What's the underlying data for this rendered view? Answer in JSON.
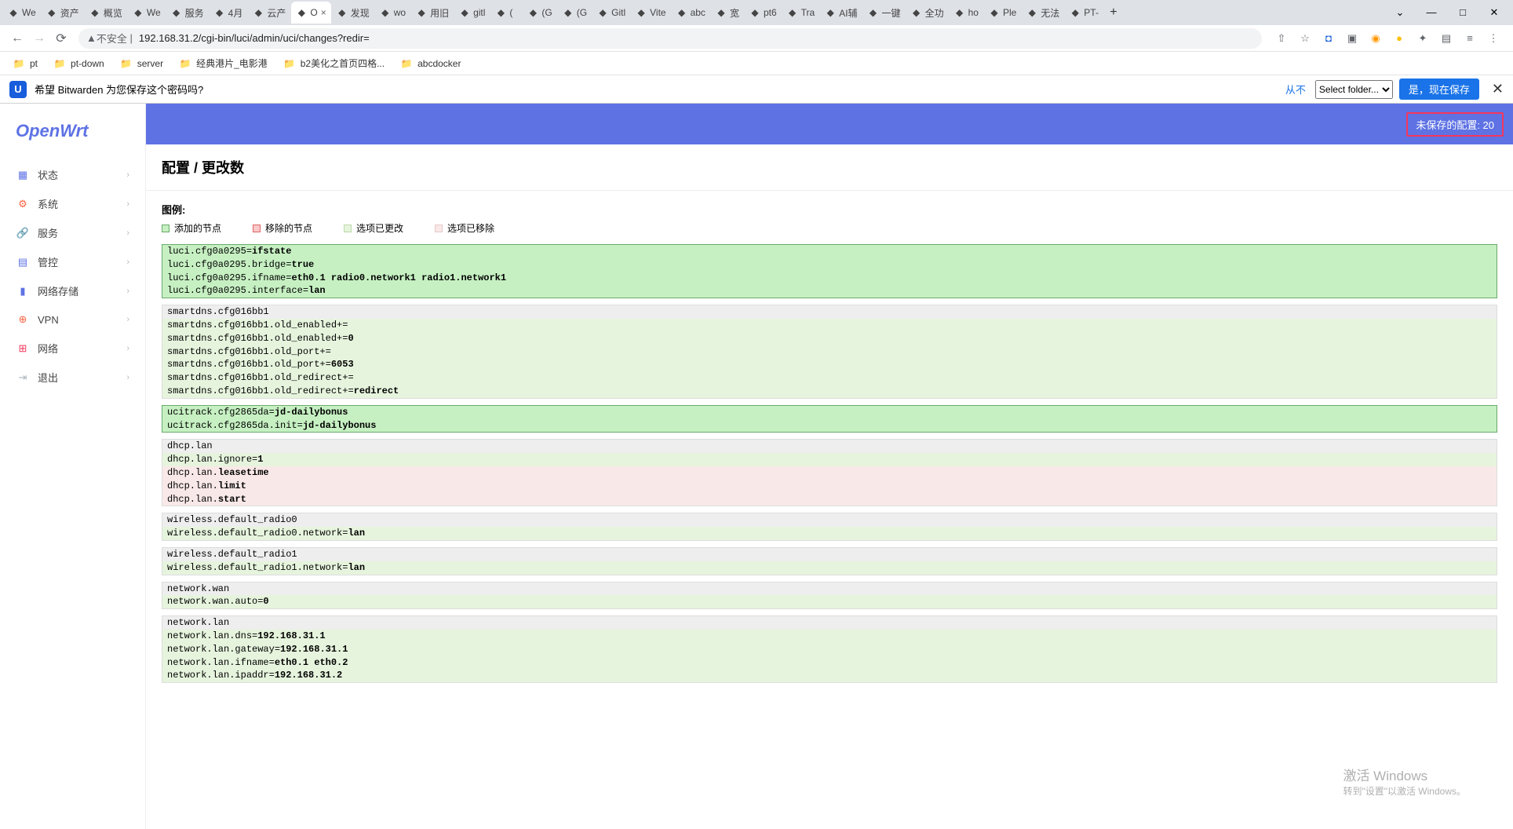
{
  "browser": {
    "tabs": [
      {
        "label": "We"
      },
      {
        "label": "资产"
      },
      {
        "label": "概览"
      },
      {
        "label": "We"
      },
      {
        "label": "服务"
      },
      {
        "label": "4月"
      },
      {
        "label": "云产"
      },
      {
        "label": "O",
        "active": true
      },
      {
        "label": "发现"
      },
      {
        "label": "wo"
      },
      {
        "label": "用旧"
      },
      {
        "label": "gitl"
      },
      {
        "label": "("
      },
      {
        "label": "(G"
      },
      {
        "label": "(G"
      },
      {
        "label": "Gitl"
      },
      {
        "label": "Vite"
      },
      {
        "label": "abc"
      },
      {
        "label": "宽"
      },
      {
        "label": "pt6"
      },
      {
        "label": "Tra"
      },
      {
        "label": "AI辅"
      },
      {
        "label": "一键"
      },
      {
        "label": "全功"
      },
      {
        "label": "ho"
      },
      {
        "label": "Ple"
      },
      {
        "label": "无法"
      },
      {
        "label": "PT-"
      }
    ],
    "url_insecure": "不安全",
    "url": "192.168.31.2/cgi-bin/luci/admin/uci/changes?redir=",
    "bookmarks": [
      {
        "label": "pt"
      },
      {
        "label": "pt-down"
      },
      {
        "label": "server"
      },
      {
        "label": "经典港片_电影港"
      },
      {
        "label": "b2美化之首页四格..."
      },
      {
        "label": "abcdocker"
      }
    ]
  },
  "bitwarden": {
    "prompt": "希望 Bitwarden 为您保存这个密码吗?",
    "never": "从不",
    "folder_placeholder": "Select folder...",
    "save": "是，现在保存"
  },
  "app": {
    "logo": "OpenWrt",
    "nav": [
      {
        "label": "状态",
        "icon": "dashboard",
        "color": "#5e72e4"
      },
      {
        "label": "系统",
        "icon": "gear",
        "color": "#fb6340"
      },
      {
        "label": "服务",
        "icon": "share",
        "color": "#2dce89"
      },
      {
        "label": "管控",
        "icon": "list",
        "color": "#5e72e4"
      },
      {
        "label": "网络存储",
        "icon": "sd",
        "color": "#5e72e4"
      },
      {
        "label": "VPN",
        "icon": "vpn",
        "color": "#fb6340"
      },
      {
        "label": "网络",
        "icon": "network",
        "color": "#f5365c"
      },
      {
        "label": "退出",
        "icon": "logout",
        "color": "#adb5bd"
      }
    ],
    "unsaved_label": "未保存的配置: 20",
    "page_title": "配置 / 更改数",
    "legend_title": "图例:",
    "legend": {
      "add": "添加的节点",
      "remove": "移除的节点",
      "changed": "选项已更改",
      "removed_opt": "选项已移除"
    },
    "blocks": [
      {
        "type": "addsection",
        "lines": [
          {
            "pre": "luci.cfg0a0295=",
            "val": "ifstate"
          },
          {
            "pre": "luci.cfg0a0295.bridge=",
            "val": "true"
          },
          {
            "pre": "luci.cfg0a0295.ifname=",
            "val": "eth0.1 radio0.network1 radio1.network1"
          },
          {
            "pre": "luci.cfg0a0295.interface=",
            "val": "lan"
          }
        ]
      },
      {
        "type": "mixed",
        "lines": [
          {
            "pre": "smartdns.cfg016bb1",
            "val": "",
            "style": "header"
          },
          {
            "pre": "smartdns.cfg016bb1.old_enabled+=",
            "val": "",
            "style": "changed"
          },
          {
            "pre": "smartdns.cfg016bb1.old_enabled+=",
            "val": "0",
            "style": "changed"
          },
          {
            "pre": "smartdns.cfg016bb1.old_port+=",
            "val": "",
            "style": "changed"
          },
          {
            "pre": "smartdns.cfg016bb1.old_port+=",
            "val": "6053",
            "style": "changed"
          },
          {
            "pre": "smartdns.cfg016bb1.old_redirect+=",
            "val": "",
            "style": "changed"
          },
          {
            "pre": "smartdns.cfg016bb1.old_redirect+=",
            "val": "redirect",
            "style": "changed"
          }
        ]
      },
      {
        "type": "addsection",
        "lines": [
          {
            "pre": "ucitrack.cfg2865da=",
            "val": "jd-dailybonus"
          },
          {
            "pre": "ucitrack.cfg2865da.init=",
            "val": "jd-dailybonus"
          }
        ]
      },
      {
        "type": "mixed",
        "lines": [
          {
            "pre": "dhcp.lan",
            "val": "",
            "style": "header"
          },
          {
            "pre": "dhcp.lan.ignore=",
            "val": "1",
            "style": "changed"
          },
          {
            "pre": "dhcp.lan.",
            "val": "leasetime",
            "style": "removed"
          },
          {
            "pre": "dhcp.lan.",
            "val": "limit",
            "style": "removed"
          },
          {
            "pre": "dhcp.lan.",
            "val": "start",
            "style": "removed"
          }
        ]
      },
      {
        "type": "mixed",
        "lines": [
          {
            "pre": "wireless.default_radio0",
            "val": "",
            "style": "header"
          },
          {
            "pre": "wireless.default_radio0.network=",
            "val": "lan",
            "style": "changed"
          }
        ]
      },
      {
        "type": "mixed",
        "lines": [
          {
            "pre": "wireless.default_radio1",
            "val": "",
            "style": "header"
          },
          {
            "pre": "wireless.default_radio1.network=",
            "val": "lan",
            "style": "changed"
          }
        ]
      },
      {
        "type": "mixed",
        "lines": [
          {
            "pre": "network.wan",
            "val": "",
            "style": "header"
          },
          {
            "pre": "network.wan.auto=",
            "val": "0",
            "style": "changed"
          }
        ]
      },
      {
        "type": "mixed",
        "lines": [
          {
            "pre": "network.lan",
            "val": "",
            "style": "header"
          },
          {
            "pre": "network.lan.dns=",
            "val": "192.168.31.1",
            "style": "changed"
          },
          {
            "pre": "network.lan.gateway=",
            "val": "192.168.31.1",
            "style": "changed"
          },
          {
            "pre": "network.lan.ifname=",
            "val": "eth0.1 eth0.2",
            "style": "changed"
          },
          {
            "pre": "network.lan.ipaddr=",
            "val": "192.168.31.2",
            "style": "changed"
          }
        ]
      }
    ],
    "watermark": {
      "title": "激活 Windows",
      "sub": "转到\"设置\"以激活 Windows。"
    }
  }
}
